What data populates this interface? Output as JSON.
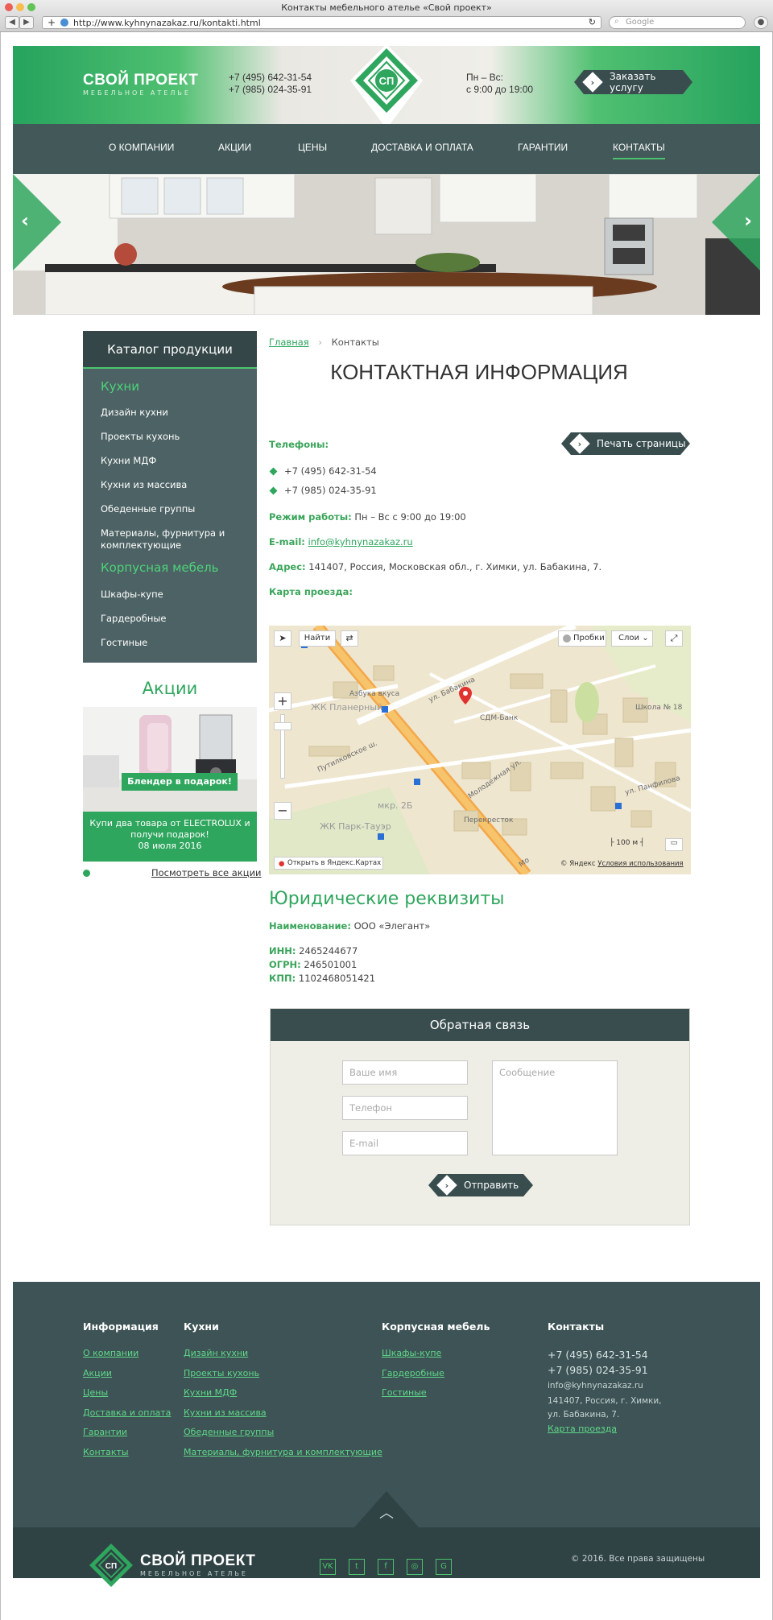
{
  "browser": {
    "title": "Контакты мебельного ателье «Свой проект»",
    "url": "http://www.kyhnynazakaz.ru/kontakti.html",
    "search_placeholder": "Google"
  },
  "header": {
    "brand": "СВОЙ ПРОЕКТ",
    "brand_sub": "МЕБЕЛЬНОЕ АТЕЛЬЕ",
    "phone1": "+7 (495) 642-31-54",
    "phone2": "+7 (985) 024-35-91",
    "logo_text": "СП",
    "hours_title": "Пн – Вс:",
    "hours": "с 9:00 до 19:00",
    "order_button": "Заказать услугу"
  },
  "nav": [
    {
      "label": "О КОМПАНИИ"
    },
    {
      "label": "АКЦИИ"
    },
    {
      "label": "ЦЕНЫ"
    },
    {
      "label": "ДОСТАВКА И ОПЛАТА"
    },
    {
      "label": "ГАРАНТИИ"
    },
    {
      "label": "КОНТАКТЫ",
      "active": true
    }
  ],
  "sidebar": {
    "title": "Каталог продукции",
    "cat1": "Кухни",
    "cat1_items": [
      "Дизайн кухни",
      "Проекты кухонь",
      "Кухни МДФ",
      "Кухни из массива",
      "Обеденные группы",
      "Материалы, фурнитура и комплектующие"
    ],
    "cat2": "Корпусная мебель",
    "cat2_items": [
      "Шкафы-купе",
      "Гардеробные",
      "Гостиные"
    ]
  },
  "promo": {
    "title": "Акции",
    "banner_label": "Блендер в подарок!",
    "caption": "Купи два товара от ELECTROLUX и получи подарок!",
    "date": "08 июля 2016",
    "all_link": "Посмотреть все акции"
  },
  "content": {
    "breadcrumb_home": "Главная",
    "breadcrumb_current": "Контакты",
    "title": "КОНТАКТНАЯ ИНФОРМАЦИЯ",
    "phones_label": "Телефоны:",
    "print_button": "Печать страницы",
    "phone1": "+7 (495) 642-31-54",
    "phone2": "+7 (985) 024-35-91",
    "hours_label": "Режим работы:",
    "hours_value": "Пн – Вс с 9:00 до 19:00",
    "email_label": "E-mail:",
    "email_value": "info@kyhnynazakaz.ru",
    "address_label": "Адрес:",
    "address_value": "141407, Россия, Московская обл., г. Химки, ул. Бабакина, 7.",
    "map_label": "Карта проезда:"
  },
  "map": {
    "find": "Найти",
    "traffic": "Пробки",
    "layers": "Слои",
    "open_link": "Открыть в Яндекс.Картах",
    "copyright": "© Яндекс",
    "terms": "Условия использования",
    "scale": "100 м",
    "labels": [
      "ЖК Планерный",
      "Азбука вкуса",
      "ул. Бабакина",
      "СДМ-Банк",
      "Школа № 18",
      "Путилковское ш.",
      "Молодежная ул.",
      "мкр. 2Б",
      "ЖК Парк-Тауэр",
      "Перекресток",
      "ул. Панфилова",
      "Мо"
    ]
  },
  "legal": {
    "title": "Юридические реквизиты",
    "name_label": "Наименование:",
    "name_value": "ООО «Элегант»",
    "inn_label": "ИНН:",
    "inn_value": "2465244677",
    "ogrn_label": "ОГРН:",
    "ogrn_value": "246501001",
    "kpp_label": "КПП:",
    "kpp_value": "1102468051421"
  },
  "feedback": {
    "title": "Обратная связь",
    "name_placeholder": "Ваше имя",
    "phone_placeholder": "Телефон",
    "email_placeholder": "E-mail",
    "message_placeholder": "Сообщение",
    "submit": "Отправить"
  },
  "footer": {
    "col1_title": "Информация",
    "col1_links": [
      "О компании",
      "Акции",
      "Цены",
      "Доставка и оплата",
      "Гарантии",
      "Контакты"
    ],
    "col2_title": "Кухни",
    "col2_links": [
      "Дизайн кухни",
      "Проекты кухонь",
      "Кухни МДФ",
      "Кухни из массива",
      "Обеденные группы",
      "Материалы, фурнитура и комплектующие"
    ],
    "col3_title": "Корпусная мебель",
    "col3_links": [
      "Шкафы-купе",
      "Гардеробные",
      "Гостиные"
    ],
    "col4_title": "Контакты",
    "phone1": "+7 (495) 642-31-54",
    "phone2": "+7 (985) 024-35-91",
    "email": "info@kyhnynazakaz.ru",
    "address": "141407, Россия, г. Химки, ул. Бабакина, 7.",
    "map_link": "Карта проезда",
    "brand": "СВОЙ ПРОЕКТ",
    "brand_sub": "МЕБЕЛЬНОЕ АТЕЛЬЕ",
    "logo_text": "СП",
    "copyright": "© 2016. Все права защищены",
    "social": [
      "vk-icon",
      "twitter-icon",
      "facebook-icon",
      "instagram-icon",
      "google-icon"
    ],
    "social_glyphs": [
      "VK",
      "t",
      "f",
      "◎",
      "G"
    ]
  },
  "colors": {
    "brand_green": "#2fa65e",
    "dark": "#3d5355",
    "accent_green": "#4cc36e"
  }
}
